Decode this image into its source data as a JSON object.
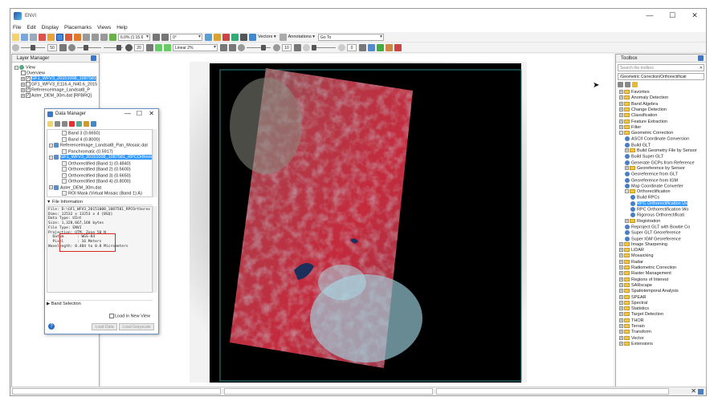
{
  "app": {
    "title": "ENVI",
    "window_buttons": [
      "—",
      "☐",
      "✕"
    ],
    "menu": [
      "File",
      "Edit",
      "Display",
      "Placemarks",
      "Views",
      "Help"
    ]
  },
  "toolbar1": {
    "zoom_value": "6.0% (1:15.6",
    "rotation_value": "0°",
    "vectors_label": "Vectors",
    "annotations_label": "Annotations",
    "goto_label": "Go To"
  },
  "toolbar2": {
    "brightness": "50",
    "contrast": "20",
    "stretch": "Linear 2%",
    "sharpen": "10",
    "transparency": "0"
  },
  "layer_manager": {
    "title": "Layer Manager",
    "items": [
      {
        "label": "View"
      },
      {
        "label": "Overview"
      },
      {
        "label": "GF1_WFV3_20151008_1087581"
      },
      {
        "label": "GF1_WFV3_E116.4_N40.6_2015"
      },
      {
        "label": "ReferenceImage_Landsat8_P"
      },
      {
        "label": "Aster_DEM_30m.dat [RFBRQ]"
      }
    ]
  },
  "data_manager": {
    "title": "Data Manager",
    "tree": [
      {
        "label": "Band 3 (0.6650)",
        "type": "band"
      },
      {
        "label": "Band 4 (0.8000)",
        "type": "band"
      },
      {
        "label": "ReferenceImage_Landsat8_Pan_Mosaic.dat",
        "type": "file"
      },
      {
        "label": "Panchromatic (0.5917)",
        "type": "band"
      },
      {
        "label": "GF1_WFV3_20151008_1087581_RPCOrthorecti",
        "type": "file"
      },
      {
        "label": "Orthorectified (Band 1) (0.4840)",
        "type": "band"
      },
      {
        "label": "Orthorectified (Band 2) (0.5600)",
        "type": "band"
      },
      {
        "label": "Orthorectified (Band 3) (0.6650)",
        "type": "band"
      },
      {
        "label": "Orthorectified (Band 4) (0.8000)",
        "type": "band"
      },
      {
        "label": "Aster_DEM_30m.dat",
        "type": "file"
      },
      {
        "label": "ROI Mask (Virtual Mosaic (Band 1):A)",
        "type": "band"
      }
    ],
    "file_info_header": "File Information",
    "file_info": [
      "File: D:\\GF1_WFV3_20151008_1087581_RPCOrthorec",
      "Dims: 12532 x 13253 x 4 [BSQ]",
      "Data Type: UInt",
      "Size: 1,328,667,168 bytes",
      "File Type: ENVI",
      "Projection: UTM, Zone 50 N",
      "  Datum      : WGS-84",
      "  Pixel      : 16 Meters",
      "Wavelength: 0.484 to 0.8 Micrometers"
    ],
    "band_selection": "Band Selection",
    "load_new_view": "Load in New View",
    "load_data": "Load Data",
    "load_grayscale": "Load Grayscale"
  },
  "toolbox": {
    "title": "Toolbox",
    "search_placeholder": "Search the toolbox",
    "path": "/Geometric Correction/Orthorectificati",
    "items": [
      {
        "label": "Favorites",
        "type": "folder",
        "level": 0
      },
      {
        "label": "Anomaly Detection",
        "type": "folder",
        "level": 0
      },
      {
        "label": "Band Algebra",
        "type": "folder",
        "level": 0
      },
      {
        "label": "Change Detection",
        "type": "folder",
        "level": 0
      },
      {
        "label": "Classification",
        "type": "folder",
        "level": 0
      },
      {
        "label": "Feature Extraction",
        "type": "folder",
        "level": 0
      },
      {
        "label": "Filter",
        "type": "folder",
        "level": 0
      },
      {
        "label": "Geometric Correction",
        "type": "folder",
        "level": 0
      },
      {
        "label": "ASCII Coordinate Conversion",
        "type": "tool",
        "level": 1
      },
      {
        "label": "Build GLT",
        "type": "tool",
        "level": 1
      },
      {
        "label": "Build Geometry File by Sensor",
        "type": "folder",
        "level": 1
      },
      {
        "label": "Build Super GLT",
        "type": "tool",
        "level": 1
      },
      {
        "label": "Generate GCPs from Reference",
        "type": "tool",
        "level": 1
      },
      {
        "label": "Georeference by Sensor",
        "type": "folder",
        "level": 1
      },
      {
        "label": "Georeference from GLT",
        "type": "tool",
        "level": 1
      },
      {
        "label": "Georeference from IGM",
        "type": "tool",
        "level": 1
      },
      {
        "label": "Map Coordinate Converter",
        "type": "tool",
        "level": 1
      },
      {
        "label": "Orthorectification",
        "type": "folder",
        "level": 1
      },
      {
        "label": "Build RPCs",
        "type": "tool",
        "level": 2
      },
      {
        "label": "RPC Orthorectification Us",
        "type": "tool",
        "level": 2,
        "selected": true
      },
      {
        "label": "RPC Orthorectification Wo",
        "type": "tool",
        "level": 2
      },
      {
        "label": "Rigorous Orthorectificati",
        "type": "tool",
        "level": 2
      },
      {
        "label": "Registration",
        "type": "folder",
        "level": 1
      },
      {
        "label": "Reproject GLT with Bowtie Co",
        "type": "tool",
        "level": 1
      },
      {
        "label": "Super GLT Georeference",
        "type": "tool",
        "level": 1
      },
      {
        "label": "Super IGM Georeference",
        "type": "tool",
        "level": 1
      },
      {
        "label": "Image Sharpening",
        "type": "folder",
        "level": 0
      },
      {
        "label": "LiDAR",
        "type": "folder",
        "level": 0
      },
      {
        "label": "Mosaicking",
        "type": "folder",
        "level": 0
      },
      {
        "label": "Radar",
        "type": "folder",
        "level": 0
      },
      {
        "label": "Radiometric Correction",
        "type": "folder",
        "level": 0
      },
      {
        "label": "Raster Management",
        "type": "folder",
        "level": 0
      },
      {
        "label": "Regions of Interest",
        "type": "folder",
        "level": 0
      },
      {
        "label": "SARscape",
        "type": "folder",
        "level": 0
      },
      {
        "label": "Spatiotemporal Analysis",
        "type": "folder",
        "level": 0
      },
      {
        "label": "SPEAR",
        "type": "folder",
        "level": 0
      },
      {
        "label": "Spectral",
        "type": "folder",
        "level": 0
      },
      {
        "label": "Statistics",
        "type": "folder",
        "level": 0
      },
      {
        "label": "Target Detection",
        "type": "folder",
        "level": 0
      },
      {
        "label": "THOR",
        "type": "folder",
        "level": 0
      },
      {
        "label": "Terrain",
        "type": "folder",
        "level": 0
      },
      {
        "label": "Transform",
        "type": "folder",
        "level": 0
      },
      {
        "label": "Vector",
        "type": "folder",
        "level": 0
      },
      {
        "label": "Extensions",
        "type": "folder",
        "level": 0
      }
    ]
  },
  "colors": {
    "selection": "#3399ff",
    "annotation_box": "#d9261c",
    "image_vegetation": "#c0283a",
    "image_city": "#8ecfe0"
  }
}
